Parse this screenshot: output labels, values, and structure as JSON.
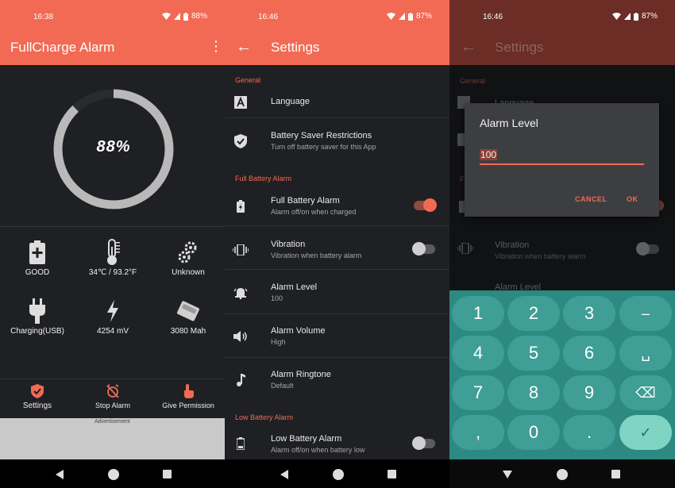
{
  "screen1": {
    "status": {
      "time": "16:38",
      "battery_pct": "88%"
    },
    "title": "FullCharge Alarm",
    "menu_icon": "more-vert-icon",
    "battery_level_text": "88%",
    "battery_level_value": 0.88,
    "stats": [
      {
        "icon": "battery-health-icon",
        "label": "GOOD"
      },
      {
        "icon": "thermometer-icon",
        "label": "34℃ / 93.2°F"
      },
      {
        "icon": "gears-icon",
        "label": "Unknown"
      },
      {
        "icon": "plug-icon",
        "label": "Charging(USB)"
      },
      {
        "icon": "lightning-icon",
        "label": "4254 mV"
      },
      {
        "icon": "battery-pack-icon",
        "label": "3080 Mah"
      }
    ],
    "bottom_nav": [
      {
        "icon": "shield-icon",
        "label": "Settings"
      },
      {
        "icon": "alarm-off-icon",
        "label": "Stop Alarm"
      },
      {
        "icon": "hand-tap-icon",
        "label": "Give Permission"
      }
    ],
    "ad_label": "Advertisement"
  },
  "screen2": {
    "status": {
      "time": "16:46",
      "battery_pct": "87%"
    },
    "title": "Settings",
    "sections": {
      "general": "General",
      "full": "Full Battery Alarm",
      "low": "Low Battery Alarm"
    },
    "rows": {
      "language": {
        "title": "Language"
      },
      "saver": {
        "title": "Battery Saver Restrictions",
        "subtitle": "Turn off battery saver for this App"
      },
      "full_alarm": {
        "title": "Full Battery Alarm",
        "subtitle": "Alarm off/on when charged",
        "toggle": true
      },
      "vibration": {
        "title": "Vibration",
        "subtitle": "Vibration when battery alarm",
        "toggle": false
      },
      "level": {
        "title": "Alarm Level",
        "subtitle": "100"
      },
      "volume": {
        "title": "Alarm Volume",
        "subtitle": "High"
      },
      "ringtone": {
        "title": "Alarm Ringtone",
        "subtitle": "Default"
      },
      "low_alarm": {
        "title": "Low Battery Alarm",
        "subtitle": "Alarm off/on when battery low",
        "toggle": false
      }
    }
  },
  "screen3": {
    "status": {
      "time": "16:46",
      "battery_pct": "87%"
    },
    "title": "Settings",
    "bg": {
      "general": "General",
      "language": "Language",
      "vibration": "Vibration",
      "vibration_sub": "Vibration when battery alarm",
      "level": "Alarm Level",
      "full_initial": "F"
    },
    "dialog": {
      "title": "Alarm Level",
      "value": "100",
      "cancel": "CANCEL",
      "ok": "OK"
    },
    "keys": [
      "1",
      "2",
      "3",
      "–",
      "4",
      "5",
      "6",
      "␣",
      "7",
      "8",
      "9",
      "⌫",
      ",",
      "0",
      ".",
      "✓"
    ]
  },
  "colors": {
    "accent": "#f26a54",
    "bg_dark": "#1f2023",
    "keyboard": "#2c8a82"
  }
}
